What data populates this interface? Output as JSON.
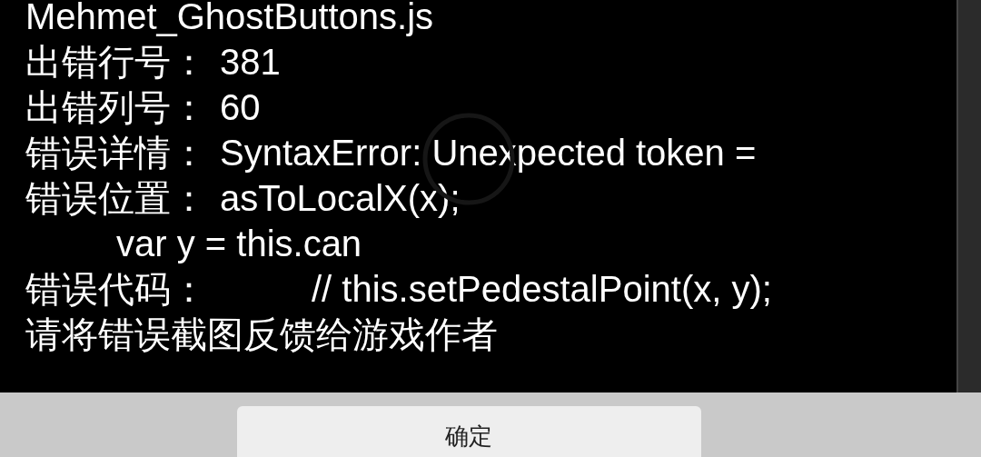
{
  "file_name": "Mehmet_GhostButtons.js",
  "rows": [
    {
      "kind": "field",
      "label": "出错行号：",
      "value": "381"
    },
    {
      "kind": "field",
      "label": "出错列号：",
      "value": "60"
    },
    {
      "kind": "field",
      "label": "错误详情：",
      "value": "SyntaxError: Unexpected token ="
    },
    {
      "kind": "field",
      "label": "错误位置：",
      "value": "asToLocalX(x);"
    },
    {
      "kind": "continuation",
      "value": "var y = this.can"
    },
    {
      "kind": "code",
      "label": "错误代码：",
      "value": "// this.setPedestalPoint(x, y);"
    }
  ],
  "message": "请将错误截图反馈给游戏作者",
  "button": "确定"
}
